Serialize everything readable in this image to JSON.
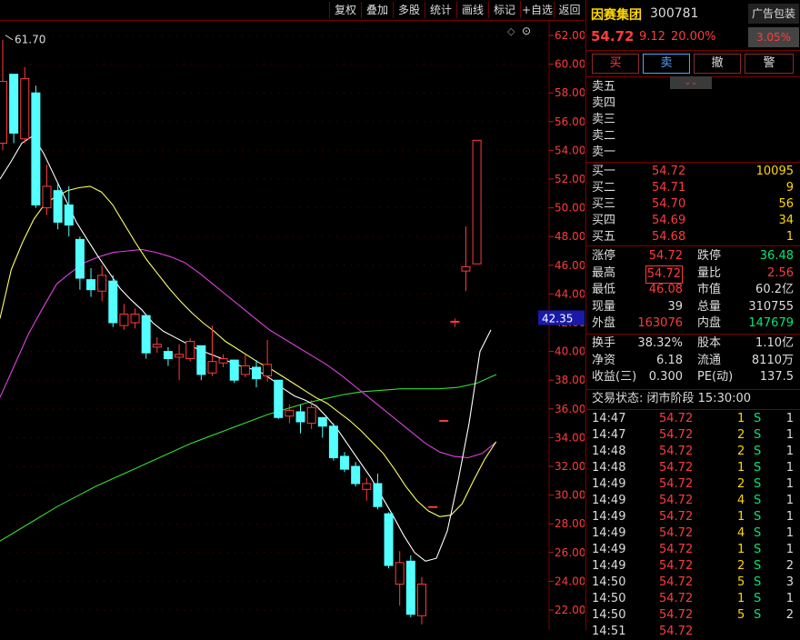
{
  "toolbar": [
    "复权",
    "叠加",
    "多股",
    "统计",
    "画线",
    "标记",
    "+自选",
    "返回"
  ],
  "chart": {
    "peak_label": "61.70",
    "price_axis": [
      "62.00",
      "60.00",
      "58.00",
      "56.00",
      "54.00",
      "52.00",
      "50.00",
      "48.00",
      "46.00",
      "44.00",
      "42.00",
      "40.00",
      "38.00",
      "36.00",
      "34.00",
      "32.00",
      "30.00",
      "28.00",
      "26.00",
      "24.00",
      "22.00"
    ],
    "cursor_price": "42.35",
    "cursor_color": "#1a1aa8"
  },
  "stock": {
    "name": "因赛集团",
    "code": "300781",
    "ad_tag": "广告包装",
    "price": "54.72",
    "change": "9.12",
    "change_pct": "20.00%",
    "sector_pct": "3.05%"
  },
  "actions": [
    "买",
    "卖",
    "撤",
    "警"
  ],
  "sell_levels": [
    "卖五",
    "卖四",
    "卖三",
    "卖二",
    "卖一"
  ],
  "buy_levels": [
    {
      "label": "买一",
      "price": "54.72",
      "vol": "10095"
    },
    {
      "label": "买二",
      "price": "54.71",
      "vol": "9"
    },
    {
      "label": "买三",
      "price": "54.70",
      "vol": "56"
    },
    {
      "label": "买四",
      "price": "54.69",
      "vol": "34"
    },
    {
      "label": "买五",
      "price": "54.68",
      "vol": "1"
    }
  ],
  "stats_a": [
    {
      "l1": "涨停",
      "v1": "54.72",
      "c1": "red",
      "l2": "跌停",
      "v2": "36.48",
      "c2": "grn"
    },
    {
      "l1": "最高",
      "v1": "54.72",
      "c1": "red",
      "l2": "量比",
      "v2": "2.56",
      "c2": "red"
    },
    {
      "l1": "最低",
      "v1": "46.08",
      "c1": "red",
      "l2": "市值",
      "v2": "60.2亿",
      "c2": "wht"
    },
    {
      "l1": "现量",
      "v1": "39",
      "c1": "wht",
      "l2": "总量",
      "v2": "310755",
      "c2": "wht"
    },
    {
      "l1": "外盘",
      "v1": "163076",
      "c1": "red",
      "l2": "内盘",
      "v2": "147679",
      "c2": "grn"
    }
  ],
  "stats_b": [
    {
      "l1": "换手",
      "v1": "38.32%",
      "l2": "股本",
      "v2": "1.10亿"
    },
    {
      "l1": "净资",
      "v1": "6.18",
      "l2": "流通",
      "v2": "8110万"
    },
    {
      "l1": "收益(三)",
      "v1": "0.300",
      "l2": "PE(动)",
      "v2": "137.5"
    }
  ],
  "trade_status": "交易状态: 闭市阶段 15:30:00",
  "ticks": [
    {
      "time": "14:47",
      "price": "54.72",
      "vol": "1",
      "side": "S",
      "n": "1"
    },
    {
      "time": "14:47",
      "price": "54.72",
      "vol": "2",
      "side": "S",
      "n": "1"
    },
    {
      "time": "14:48",
      "price": "54.72",
      "vol": "2",
      "side": "S",
      "n": "1"
    },
    {
      "time": "14:48",
      "price": "54.72",
      "vol": "1",
      "side": "S",
      "n": "1"
    },
    {
      "time": "14:49",
      "price": "54.72",
      "vol": "2",
      "side": "S",
      "n": "1"
    },
    {
      "time": "14:49",
      "price": "54.72",
      "vol": "4",
      "side": "S",
      "n": "1"
    },
    {
      "time": "14:49",
      "price": "54.72",
      "vol": "1",
      "side": "S",
      "n": "1"
    },
    {
      "time": "14:49",
      "price": "54.72",
      "vol": "4",
      "side": "S",
      "n": "1"
    },
    {
      "time": "14:49",
      "price": "54.72",
      "vol": "1",
      "side": "S",
      "n": "1"
    },
    {
      "time": "14:49",
      "price": "54.72",
      "vol": "2",
      "side": "S",
      "n": "2"
    },
    {
      "time": "14:50",
      "price": "54.72",
      "vol": "5",
      "side": "S",
      "n": "3"
    },
    {
      "time": "14:50",
      "price": "54.72",
      "vol": "1",
      "side": "S",
      "n": "1"
    },
    {
      "time": "14:50",
      "price": "54.72",
      "vol": "5",
      "side": "S",
      "n": "2"
    },
    {
      "time": "14:51",
      "price": "54.72",
      "vol": "",
      "side": "",
      "n": ""
    }
  ],
  "chart_data": {
    "type": "candlestick",
    "price_range": [
      21,
      63
    ],
    "candles": [
      {
        "o": 54.5,
        "c": 58.8,
        "h": 61.7,
        "l": 54.0
      },
      {
        "o": 59.3,
        "c": 55.2,
        "h": 59.3,
        "l": 54.5
      },
      {
        "o": 54.8,
        "c": 59.0,
        "h": 59.8,
        "l": 54.5
      },
      {
        "o": 58.0,
        "c": 50.2,
        "h": 58.5,
        "l": 50.0
      },
      {
        "o": 50.0,
        "c": 51.5,
        "h": 53.0,
        "l": 49.5
      },
      {
        "o": 51.2,
        "c": 49.0,
        "h": 51.7,
        "l": 48.5
      },
      {
        "o": 50.2,
        "c": 48.8,
        "h": 51.5,
        "l": 48.0
      },
      {
        "o": 47.8,
        "c": 45.1,
        "h": 48.0,
        "l": 44.3
      },
      {
        "o": 45.0,
        "c": 44.3,
        "h": 45.8,
        "l": 43.8
      },
      {
        "o": 44.2,
        "c": 45.3,
        "h": 46.0,
        "l": 43.5
      },
      {
        "o": 44.9,
        "c": 42.0,
        "h": 45.3,
        "l": 41.7
      },
      {
        "o": 41.8,
        "c": 42.6,
        "h": 43.3,
        "l": 41.5
      },
      {
        "o": 42.0,
        "c": 42.6,
        "h": 43.0,
        "l": 41.6
      },
      {
        "o": 42.5,
        "c": 39.9,
        "h": 42.5,
        "l": 39.5
      },
      {
        "o": 40.3,
        "c": 40.5,
        "h": 41.0,
        "l": 39.9
      },
      {
        "o": 40.0,
        "c": 39.5,
        "h": 40.3,
        "l": 39.0
      },
      {
        "o": 39.6,
        "c": 39.8,
        "h": 40.5,
        "l": 38.0
      },
      {
        "o": 39.5,
        "c": 40.7,
        "h": 40.9,
        "l": 39.3
      },
      {
        "o": 40.4,
        "c": 38.4,
        "h": 40.4,
        "l": 38.0
      },
      {
        "o": 38.5,
        "c": 39.3,
        "h": 41.8,
        "l": 38.3
      },
      {
        "o": 39.2,
        "c": 39.5,
        "h": 39.8,
        "l": 38.9
      },
      {
        "o": 39.4,
        "c": 38.0,
        "h": 39.4,
        "l": 37.8
      },
      {
        "o": 38.4,
        "c": 39.0,
        "h": 39.8,
        "l": 38.2
      },
      {
        "o": 38.9,
        "c": 38.1,
        "h": 39.4,
        "l": 37.5
      },
      {
        "o": 38.3,
        "c": 39.1,
        "h": 40.8,
        "l": 37.9
      },
      {
        "o": 38.0,
        "c": 35.4,
        "h": 38.0,
        "l": 35.3
      },
      {
        "o": 35.5,
        "c": 35.9,
        "h": 36.3,
        "l": 35.0
      },
      {
        "o": 35.8,
        "c": 35.1,
        "h": 36.3,
        "l": 34.3
      },
      {
        "o": 35.0,
        "c": 36.1,
        "h": 36.6,
        "l": 34.6
      },
      {
        "o": 35.4,
        "c": 34.8,
        "h": 35.4,
        "l": 34.0
      },
      {
        "o": 34.8,
        "c": 32.6,
        "h": 35.0,
        "l": 32.4
      },
      {
        "o": 32.7,
        "c": 31.8,
        "h": 33.0,
        "l": 31.6
      },
      {
        "o": 32.0,
        "c": 30.8,
        "h": 32.3,
        "l": 30.6
      },
      {
        "o": 30.4,
        "c": 30.8,
        "h": 31.2,
        "l": 29.6
      },
      {
        "o": 30.8,
        "c": 29.2,
        "h": 31.5,
        "l": 29.0
      },
      {
        "o": 28.7,
        "c": 25.1,
        "h": 28.8,
        "l": 24.9
      },
      {
        "o": 23.8,
        "c": 25.3,
        "h": 26.1,
        "l": 22.3
      },
      {
        "o": 25.4,
        "c": 21.7,
        "h": 25.8,
        "l": 21.5
      },
      {
        "o": 21.6,
        "c": 23.8,
        "h": 24.3,
        "l": 21.0
      },
      {
        "o": 29.2,
        "c": 29.2,
        "h": 29.2,
        "l": 29.2
      },
      {
        "o": 35.2,
        "c": 35.2,
        "h": 35.2,
        "l": 35.2
      },
      {
        "o": 42.1,
        "c": 42.1,
        "h": 42.3,
        "l": 41.7
      },
      {
        "o": 45.6,
        "c": 45.9,
        "h": 48.7,
        "l": 44.2
      },
      {
        "o": 46.1,
        "c": 54.7,
        "h": 54.7,
        "l": 46.1
      }
    ],
    "ma_white": [
      52.0,
      53.2,
      54.5,
      55.0,
      53.8,
      52.2,
      50.6,
      49.0,
      47.8,
      46.6,
      45.5,
      44.4,
      43.6,
      42.9,
      42.0,
      41.4,
      41.0,
      40.6,
      40.2,
      39.9,
      39.6,
      39.3,
      39.0,
      38.8,
      38.5,
      38.0,
      37.4,
      36.9,
      36.6,
      36.2,
      35.4,
      34.5,
      33.4,
      32.3,
      31.2,
      29.9,
      28.6,
      27.2,
      26.0,
      25.4,
      25.6,
      27.5,
      31.0,
      35.0,
      40.0,
      41.5
    ],
    "ma_yellow": [
      42.3,
      45.7,
      47.6,
      49.2,
      50.3,
      50.8,
      51.2,
      51.4,
      51.5,
      51.1,
      50.2,
      48.9,
      47.6,
      46.4,
      45.4,
      44.4,
      43.5,
      42.7,
      42.0,
      41.4,
      40.7,
      40.2,
      39.7,
      39.2,
      38.8,
      38.3,
      37.8,
      37.3,
      36.8,
      36.4,
      35.8,
      35.2,
      34.5,
      33.7,
      32.9,
      31.8,
      30.6,
      29.6,
      28.9,
      28.5,
      28.6,
      29.4,
      31.0,
      32.5,
      33.7
    ],
    "ma_magenta": [
      36.8,
      39.0,
      41.2,
      43.0,
      44.7,
      45.5,
      46.2,
      46.6,
      46.9,
      47.0,
      47.1,
      46.9,
      46.6,
      46.2,
      45.5,
      44.7,
      43.9,
      43.1,
      42.3,
      41.5,
      40.9,
      40.3,
      39.7,
      39.1,
      38.4,
      37.6,
      36.8,
      36.0,
      35.2,
      34.4,
      33.6,
      33.0,
      32.7,
      32.6,
      32.9,
      33.7
    ],
    "ma_green": [
      26.8,
      27.6,
      28.4,
      29.2,
      29.9,
      30.6,
      31.2,
      31.8,
      32.4,
      33.0,
      33.6,
      34.1,
      34.6,
      35.1,
      35.6,
      36.0,
      36.4,
      36.7,
      37.0,
      37.2,
      37.3,
      37.4,
      37.4,
      37.4,
      37.5,
      37.8,
      38.4
    ]
  }
}
